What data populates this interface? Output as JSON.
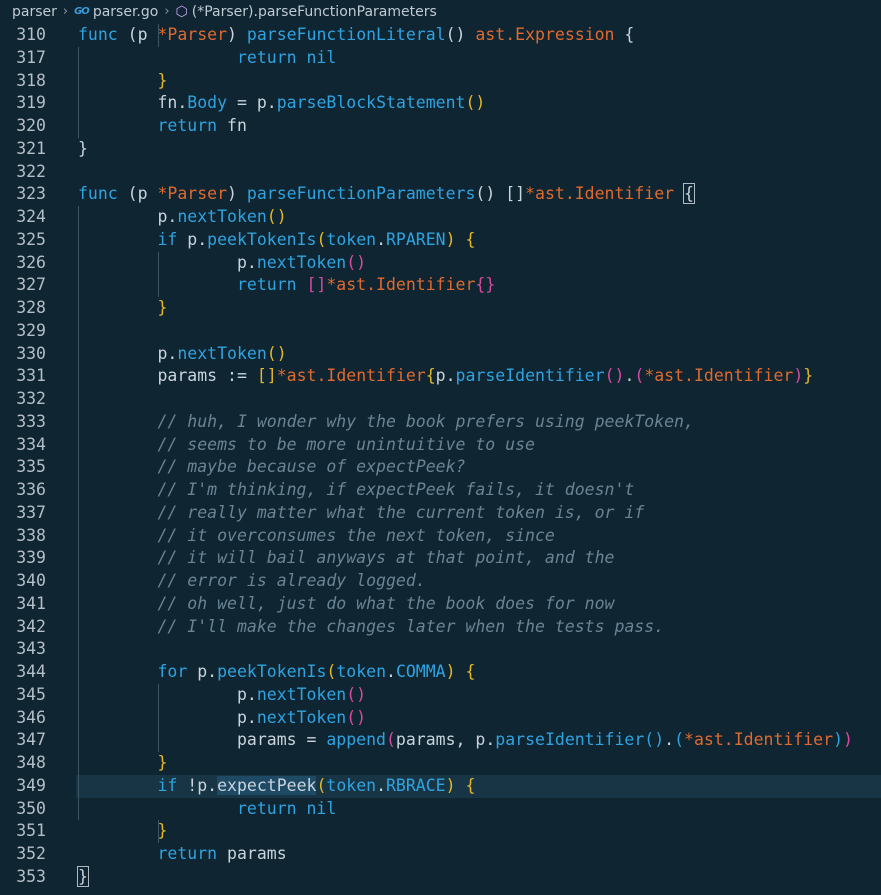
{
  "breadcrumb": {
    "folder": "parser",
    "file": "parser.go",
    "file_icon_text": "GO",
    "symbol": "(*Parser).parseFunctionParameters"
  },
  "current_line": 349,
  "lines": [
    {
      "n": 310,
      "code": [
        [
          "kw",
          "func"
        ],
        [
          "pu",
          " ("
        ],
        [
          "id",
          "p"
        ],
        [
          "pu",
          " "
        ],
        [
          "ty",
          "*Parser"
        ],
        [
          "pu",
          ") "
        ],
        [
          "fn",
          "parseFunctionLiteral"
        ],
        [
          "pu",
          "() "
        ],
        [
          "ty",
          "ast.Expression"
        ],
        [
          "pu",
          " {"
        ]
      ]
    },
    {
      "n": 317,
      "code": [
        [
          "pu",
          "\t\t"
        ],
        [
          "kw",
          "return"
        ],
        [
          "pu",
          " "
        ],
        [
          "kw",
          "nil"
        ]
      ]
    },
    {
      "n": 318,
      "code": [
        [
          "pu",
          "\t"
        ],
        [
          "b1",
          "}"
        ]
      ]
    },
    {
      "n": 319,
      "code": [
        [
          "pu",
          "\t"
        ],
        [
          "id",
          "fn"
        ],
        [
          "pu",
          "."
        ],
        [
          "fn",
          "Body"
        ],
        [
          "op",
          " = "
        ],
        [
          "id",
          "p"
        ],
        [
          "pu",
          "."
        ],
        [
          "fn",
          "parseBlockStatement"
        ],
        [
          "b1",
          "()"
        ]
      ]
    },
    {
      "n": 320,
      "code": [
        [
          "pu",
          "\t"
        ],
        [
          "kw",
          "return"
        ],
        [
          "pu",
          " "
        ],
        [
          "id",
          "fn"
        ]
      ]
    },
    {
      "n": 321,
      "code": [
        [
          "pu",
          "}"
        ]
      ]
    },
    {
      "n": 322,
      "code": []
    },
    {
      "n": 323,
      "code": [
        [
          "kw",
          "func"
        ],
        [
          "pu",
          " ("
        ],
        [
          "id",
          "p"
        ],
        [
          "pu",
          " "
        ],
        [
          "ty",
          "*Parser"
        ],
        [
          "pu",
          ") "
        ],
        [
          "fn",
          "parseFunctionParameters"
        ],
        [
          "pu",
          "() []"
        ],
        [
          "ty",
          "*ast.Identifier"
        ],
        [
          "pu",
          " "
        ],
        [
          "mb",
          "{"
        ]
      ]
    },
    {
      "n": 324,
      "code": [
        [
          "pu",
          "\t"
        ],
        [
          "id",
          "p"
        ],
        [
          "pu",
          "."
        ],
        [
          "fn",
          "nextToken"
        ],
        [
          "b1",
          "()"
        ]
      ]
    },
    {
      "n": 325,
      "code": [
        [
          "pu",
          "\t"
        ],
        [
          "kw",
          "if"
        ],
        [
          "pu",
          " "
        ],
        [
          "id",
          "p"
        ],
        [
          "pu",
          "."
        ],
        [
          "fn",
          "peekTokenIs"
        ],
        [
          "b1",
          "("
        ],
        [
          "pk",
          "token"
        ],
        [
          "pu",
          "."
        ],
        [
          "pk",
          "RPAREN"
        ],
        [
          "b1",
          ")"
        ],
        [
          "pu",
          " "
        ],
        [
          "b1",
          "{"
        ]
      ]
    },
    {
      "n": 326,
      "code": [
        [
          "pu",
          "\t\t"
        ],
        [
          "id",
          "p"
        ],
        [
          "pu",
          "."
        ],
        [
          "fn",
          "nextToken"
        ],
        [
          "b2",
          "()"
        ]
      ]
    },
    {
      "n": 327,
      "code": [
        [
          "pu",
          "\t\t"
        ],
        [
          "kw",
          "return"
        ],
        [
          "pu",
          " "
        ],
        [
          "b2",
          "[]"
        ],
        [
          "ty",
          "*ast.Identifier"
        ],
        [
          "b2",
          "{}"
        ]
      ]
    },
    {
      "n": 328,
      "code": [
        [
          "pu",
          "\t"
        ],
        [
          "b1",
          "}"
        ]
      ]
    },
    {
      "n": 329,
      "code": []
    },
    {
      "n": 330,
      "code": [
        [
          "pu",
          "\t"
        ],
        [
          "id",
          "p"
        ],
        [
          "pu",
          "."
        ],
        [
          "fn",
          "nextToken"
        ],
        [
          "b1",
          "()"
        ]
      ]
    },
    {
      "n": 331,
      "code": [
        [
          "pu",
          "\t"
        ],
        [
          "id",
          "params"
        ],
        [
          "op",
          " := "
        ],
        [
          "b1",
          "[]"
        ],
        [
          "ty",
          "*ast.Identifier"
        ],
        [
          "b1",
          "{"
        ],
        [
          "id",
          "p"
        ],
        [
          "pu",
          "."
        ],
        [
          "fn",
          "parseIdentifier"
        ],
        [
          "b2",
          "()"
        ],
        [
          "pu",
          "."
        ],
        [
          "b2",
          "("
        ],
        [
          "ty",
          "*ast.Identifier"
        ],
        [
          "b2",
          ")"
        ],
        [
          "b1",
          "}"
        ]
      ]
    },
    {
      "n": 332,
      "code": []
    },
    {
      "n": 333,
      "code": [
        [
          "pu",
          "\t"
        ],
        [
          "cm",
          "// huh, I wonder why the book prefers using peekToken,"
        ]
      ]
    },
    {
      "n": 334,
      "code": [
        [
          "pu",
          "\t"
        ],
        [
          "cm",
          "// seems to be more unintuitive to use"
        ]
      ]
    },
    {
      "n": 335,
      "code": [
        [
          "pu",
          "\t"
        ],
        [
          "cm",
          "// maybe because of expectPeek?"
        ]
      ]
    },
    {
      "n": 336,
      "code": [
        [
          "pu",
          "\t"
        ],
        [
          "cm",
          "// I'm thinking, if expectPeek fails, it doesn't"
        ]
      ]
    },
    {
      "n": 337,
      "code": [
        [
          "pu",
          "\t"
        ],
        [
          "cm",
          "// really matter what the current token is, or if"
        ]
      ]
    },
    {
      "n": 338,
      "code": [
        [
          "pu",
          "\t"
        ],
        [
          "cm",
          "// it overconsumes the next token, since"
        ]
      ]
    },
    {
      "n": 339,
      "code": [
        [
          "pu",
          "\t"
        ],
        [
          "cm",
          "// it will bail anyways at that point, and the"
        ]
      ]
    },
    {
      "n": 340,
      "code": [
        [
          "pu",
          "\t"
        ],
        [
          "cm",
          "// error is already logged."
        ]
      ]
    },
    {
      "n": 341,
      "code": [
        [
          "pu",
          "\t"
        ],
        [
          "cm",
          "// oh well, just do what the book does for now"
        ]
      ]
    },
    {
      "n": 342,
      "code": [
        [
          "pu",
          "\t"
        ],
        [
          "cm",
          "// I'll make the changes later when the tests pass."
        ]
      ]
    },
    {
      "n": 343,
      "code": []
    },
    {
      "n": 344,
      "code": [
        [
          "pu",
          "\t"
        ],
        [
          "kw",
          "for"
        ],
        [
          "pu",
          " "
        ],
        [
          "id",
          "p"
        ],
        [
          "pu",
          "."
        ],
        [
          "fn",
          "peekTokenIs"
        ],
        [
          "b1",
          "("
        ],
        [
          "pk",
          "token"
        ],
        [
          "pu",
          "."
        ],
        [
          "pk",
          "COMMA"
        ],
        [
          "b1",
          ")"
        ],
        [
          "pu",
          " "
        ],
        [
          "b1",
          "{"
        ]
      ]
    },
    {
      "n": 345,
      "code": [
        [
          "pu",
          "\t\t"
        ],
        [
          "id",
          "p"
        ],
        [
          "pu",
          "."
        ],
        [
          "fn",
          "nextToken"
        ],
        [
          "b2",
          "()"
        ]
      ]
    },
    {
      "n": 346,
      "code": [
        [
          "pu",
          "\t\t"
        ],
        [
          "id",
          "p"
        ],
        [
          "pu",
          "."
        ],
        [
          "fn",
          "nextToken"
        ],
        [
          "b2",
          "()"
        ]
      ]
    },
    {
      "n": 347,
      "code": [
        [
          "pu",
          "\t\t"
        ],
        [
          "id",
          "params"
        ],
        [
          "op",
          " = "
        ],
        [
          "fn",
          "append"
        ],
        [
          "b2",
          "("
        ],
        [
          "id",
          "params"
        ],
        [
          "pu",
          ", "
        ],
        [
          "id",
          "p"
        ],
        [
          "pu",
          "."
        ],
        [
          "fn",
          "parseIdentifier"
        ],
        [
          "b3",
          "()"
        ],
        [
          "pu",
          "."
        ],
        [
          "b3",
          "("
        ],
        [
          "ty",
          "*ast.Identifier"
        ],
        [
          "b3",
          ")"
        ],
        [
          "b2",
          ")"
        ]
      ]
    },
    {
      "n": 348,
      "code": [
        [
          "pu",
          "\t"
        ],
        [
          "b1",
          "}"
        ]
      ]
    },
    {
      "n": 349,
      "code": [
        [
          "pu",
          "\t"
        ],
        [
          "kw",
          "if"
        ],
        [
          "pu",
          " !"
        ],
        [
          "id",
          "p"
        ],
        [
          "pu",
          "."
        ],
        [
          "hl",
          "expectPeek"
        ],
        [
          "b1",
          "("
        ],
        [
          "pk",
          "token"
        ],
        [
          "pu",
          "."
        ],
        [
          "pk",
          "RBRACE"
        ],
        [
          "b1",
          ")"
        ],
        [
          "pu",
          " "
        ],
        [
          "b1",
          "{"
        ]
      ]
    },
    {
      "n": 350,
      "code": [
        [
          "pu",
          "\t\t"
        ],
        [
          "kw",
          "return"
        ],
        [
          "pu",
          " "
        ],
        [
          "kw",
          "nil"
        ]
      ]
    },
    {
      "n": 351,
      "code": [
        [
          "pu",
          "\t"
        ],
        [
          "b1",
          "}"
        ]
      ]
    },
    {
      "n": 352,
      "code": [
        [
          "pu",
          "\t"
        ],
        [
          "kw",
          "return"
        ],
        [
          "pu",
          " "
        ],
        [
          "id",
          "params"
        ]
      ]
    },
    {
      "n": 353,
      "code": [
        [
          "mb",
          "}"
        ]
      ]
    }
  ]
}
